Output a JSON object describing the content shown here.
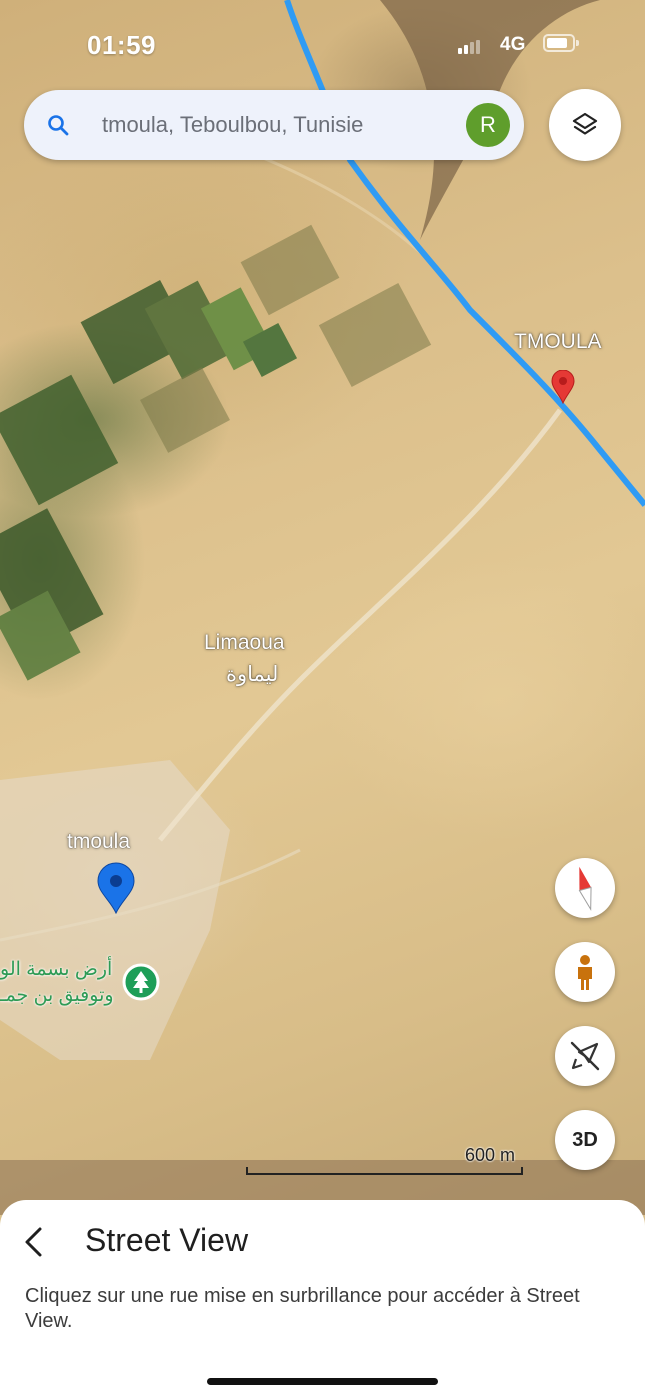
{
  "status_bar": {
    "time": "01:59",
    "network": "4G"
  },
  "search": {
    "query": "tmoula, Teboulbou, Tunisie",
    "avatar_letter": "R"
  },
  "map": {
    "labels": {
      "tmoula_upper": "TMOULA",
      "limaoua": "Limaoua",
      "limaoua_ar": "ليماوة",
      "tmoula_lower": "tmoula",
      "poi_line1": "أرض بسمة الو",
      "poi_line2": "وتوفيق بن جمـ"
    },
    "scale_text": "600 m",
    "route_color": "#2f9bf4",
    "pin_red": "#e53935",
    "pin_blue": "#1a73e8",
    "poi_green": "#1e9e58"
  },
  "controls": {
    "three_d": "3D"
  },
  "street_view": {
    "title": "Street View",
    "description": "Cliquez sur une rue mise en surbrillance pour accéder à Street View."
  }
}
